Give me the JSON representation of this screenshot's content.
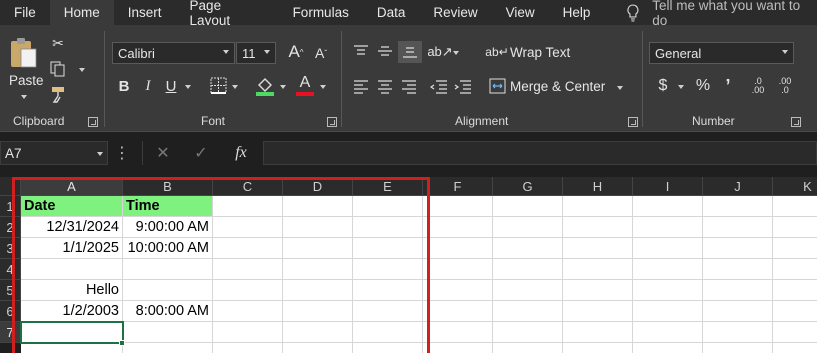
{
  "menu": {
    "items": [
      "File",
      "Home",
      "Insert",
      "Page Layout",
      "Formulas",
      "Data",
      "Review",
      "View",
      "Help"
    ],
    "active": "Home",
    "tell_me": "Tell me what you want to do"
  },
  "ribbon": {
    "clipboard": {
      "paste_label": "Paste",
      "group_label": "Clipboard"
    },
    "font": {
      "name": "Calibri",
      "size": "11",
      "bold": "B",
      "italic": "I",
      "underline": "U",
      "grow": "A",
      "shrink": "A",
      "font_color_glyph": "A",
      "group_label": "Font",
      "highlight_color": "#4cd964",
      "font_color": "#e81123"
    },
    "alignment": {
      "wrap_text": "Wrap Text",
      "merge_center": "Merge & Center",
      "group_label": "Alignment"
    },
    "number": {
      "format": "General",
      "currency": "$",
      "percent": "%",
      "comma": "’",
      "inc_dec": ".0 .00",
      "dec_dec": ".00 .0",
      "group_label": "Number"
    }
  },
  "formula_bar": {
    "name_box": "A7",
    "fx": "fx",
    "value": ""
  },
  "sheet": {
    "columns": [
      "A",
      "B",
      "C",
      "D",
      "E",
      "F",
      "G",
      "H",
      "I",
      "J",
      "K"
    ],
    "rows": [
      "1",
      "2",
      "3",
      "4",
      "5",
      "6",
      "7"
    ],
    "cells": {
      "A1": "Date",
      "B1": "Time",
      "A2": "12/31/2024",
      "B2": "9:00:00 AM",
      "A3": "1/1/2025",
      "B3": "10:00:00 AM",
      "A5": "Hello",
      "A6": "1/2/2003",
      "B6": "8:00:00 AM"
    },
    "header_fill": "#7ff17f",
    "annotation_color": "#d01f1f"
  }
}
